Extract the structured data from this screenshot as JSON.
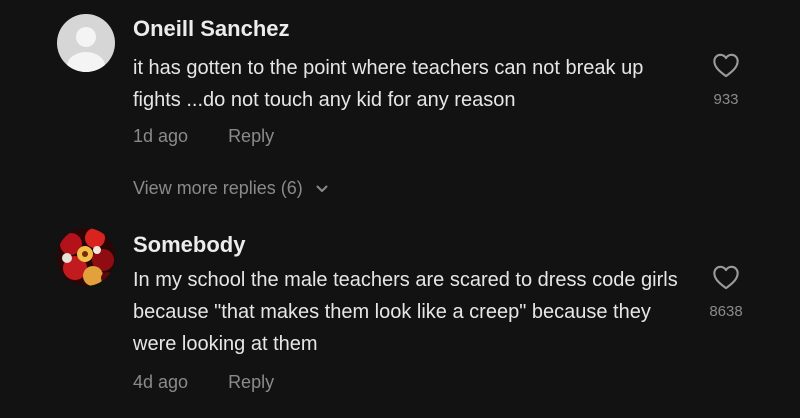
{
  "comments": [
    {
      "username": "Oneill Sanchez",
      "text": "it has gotten to the point where teachers can not break up fights ...do not touch any kid for any reason",
      "time": "1d ago",
      "reply_label": "Reply",
      "likes": "933",
      "avatar_icon": "default-avatar-icon"
    },
    {
      "username": "Somebody",
      "text": "In my school the male teachers are scared to dress code girls because \"that makes them look like a creep\" because they were looking at them",
      "time": "4d ago",
      "reply_label": "Reply",
      "likes": "8638",
      "avatar_icon": "fruit-photo-avatar"
    }
  ],
  "view_more": {
    "label": "View more replies (6)",
    "icon": "chevron-down-icon"
  },
  "icons": {
    "like": "heart-outline-icon"
  },
  "colors": {
    "background": "#121212",
    "username": "#ececec",
    "text": "#e6e6e6",
    "muted": "#8a8a8a"
  }
}
